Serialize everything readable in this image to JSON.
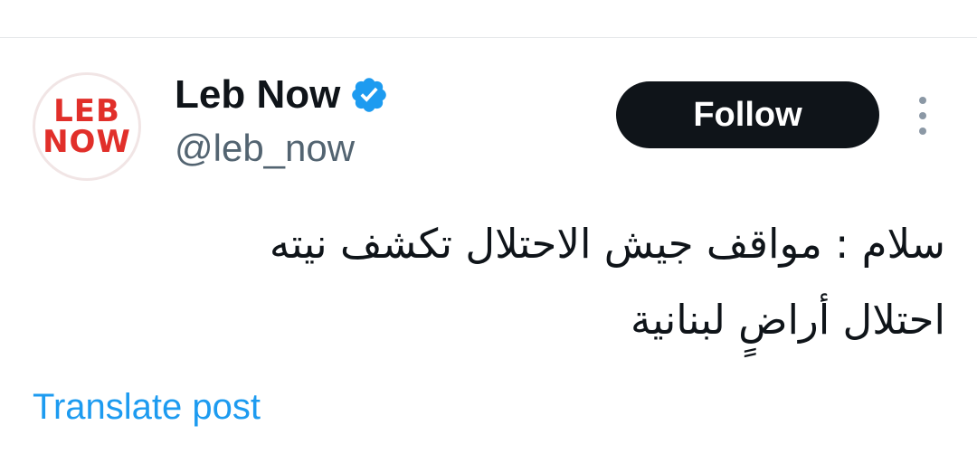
{
  "post": {
    "author": {
      "avatar_text_line1": "LEB",
      "avatar_text_line2": "NOW",
      "display_name": "Leb Now",
      "handle": "@leb_now",
      "verified": true,
      "verified_icon": "verified-badge-icon"
    },
    "actions": {
      "follow_label": "Follow",
      "more_icon": "more-vertical-icon"
    },
    "text_lines": [
      "سلام : مواقف جيش الاحتلال تكشف نيته",
      "احتلال أراضٍ لبنانية"
    ],
    "translate_label": "Translate post"
  },
  "colors": {
    "brand_red": "#e12f2a",
    "verified_blue": "#1d9bf0",
    "follow_bg": "#0f1419",
    "link_blue": "#1d9bf0",
    "secondary_text": "#536471"
  }
}
